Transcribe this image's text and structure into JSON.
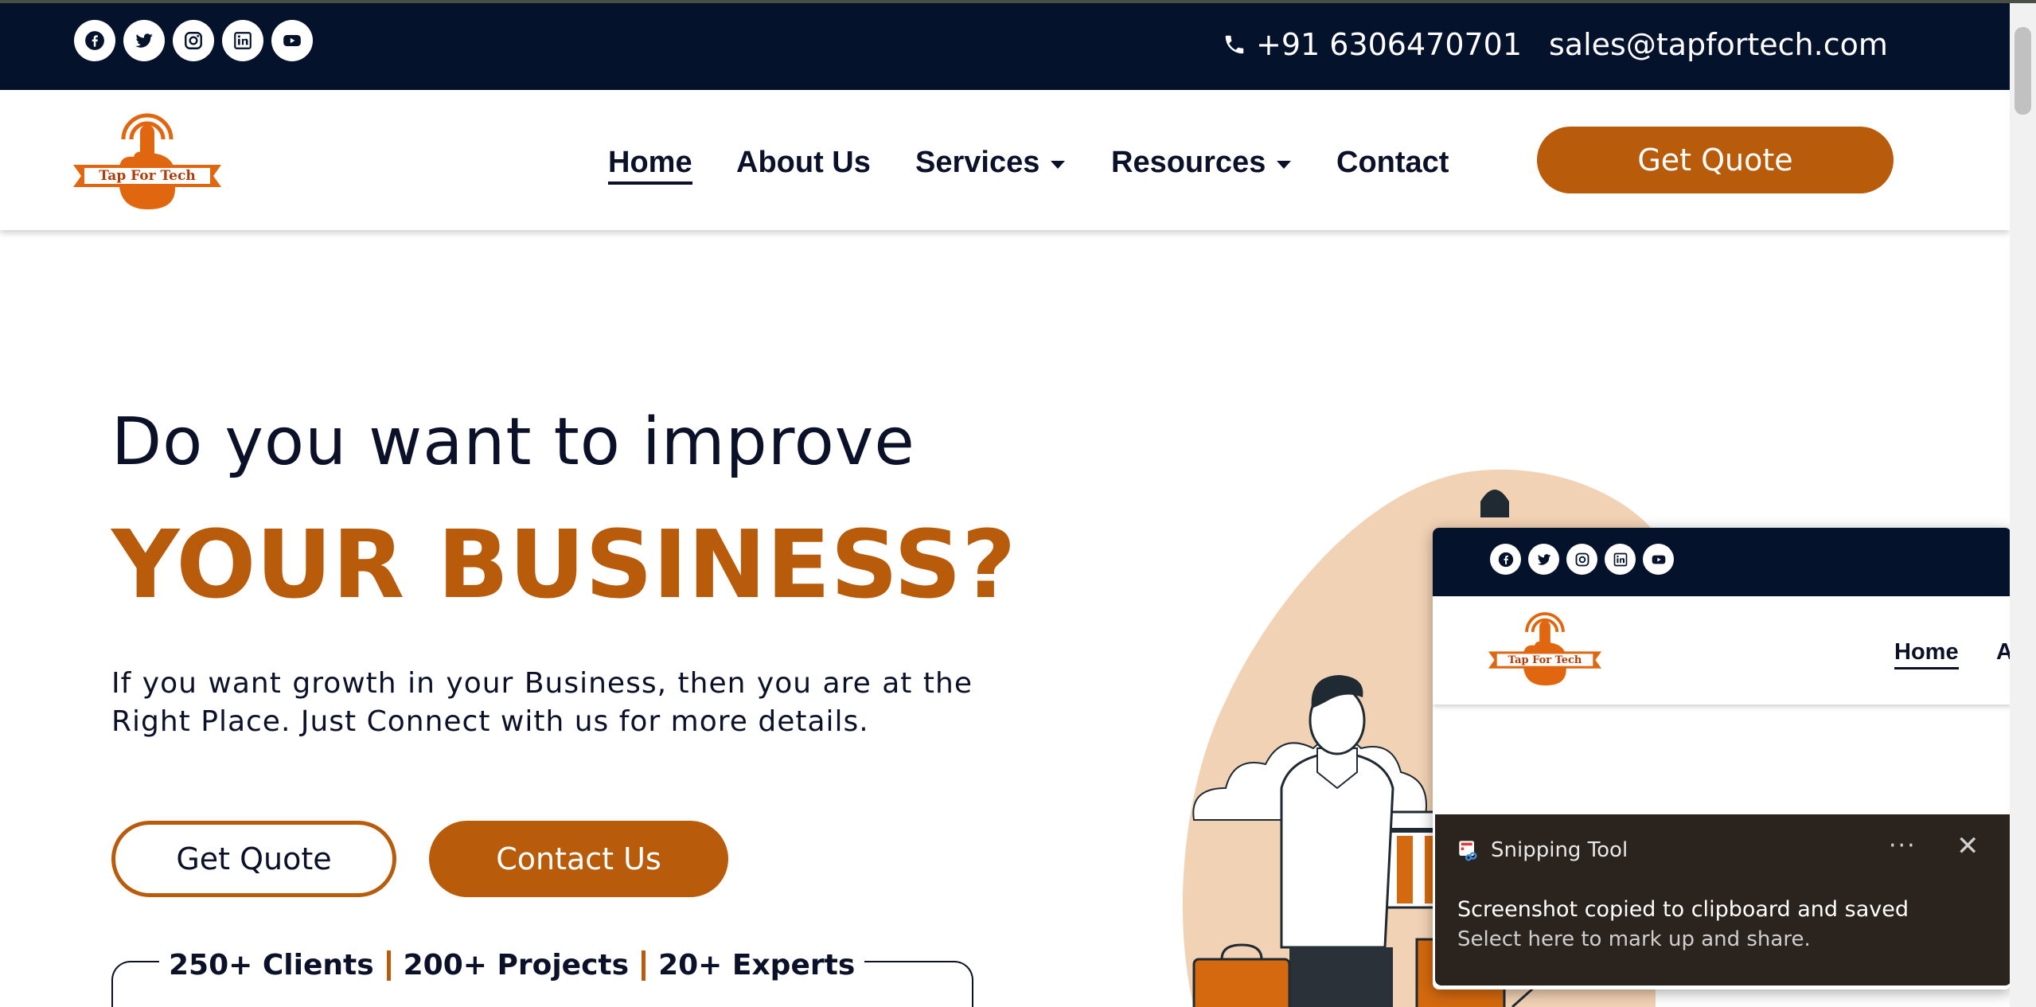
{
  "social_icons": [
    "facebook-icon",
    "twitter-icon",
    "instagram-icon",
    "linkedin-icon",
    "youtube-icon"
  ],
  "topbar": {
    "phone": "+91 6306470701",
    "email": "sales@tapfortech.com"
  },
  "logo": {
    "text": "Tap For Tech"
  },
  "nav": {
    "home": "Home",
    "about": "About Us",
    "services": "Services",
    "resources": "Resources",
    "contact": "Contact",
    "cta": "Get Quote"
  },
  "hero": {
    "line1": "Do you want to improve",
    "line2": "YOUR BUSINESS?",
    "paragraph": "If you want growth in your Business, then you are at the Right Place. Just Connect with us for more details.",
    "btn_quote": "Get Quote",
    "btn_contact": "Contact Us"
  },
  "stats": {
    "clients": "250+ Clients",
    "projects": "200+ Projects",
    "experts": "20+ Experts"
  },
  "preview": {
    "home": "Home",
    "next_initial": "A"
  },
  "toast": {
    "app": "Snipping Tool",
    "title": "Screenshot copied to clipboard and saved",
    "body": "Select here to mark up and share.",
    "more": "···",
    "close": "✕"
  },
  "colors": {
    "navy": "#05122b",
    "accent": "#b85c0b",
    "peach": "#f2d2b4"
  }
}
